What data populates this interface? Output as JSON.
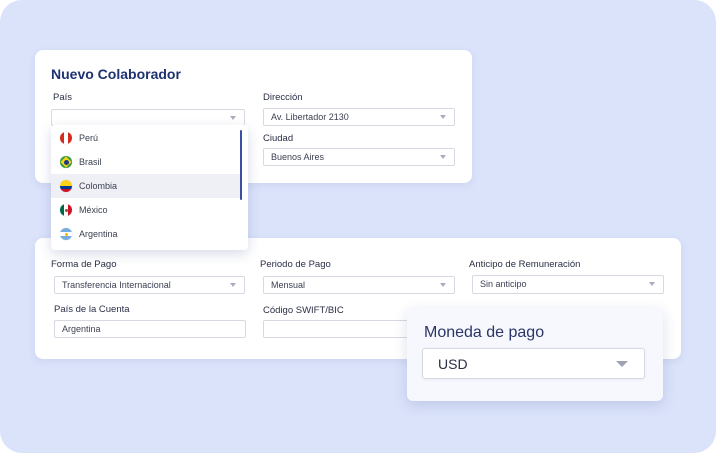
{
  "form_title": "Nuevo Colaborador",
  "top": {
    "pais": {
      "label": "País",
      "value": ""
    },
    "direccion": {
      "label": "Dirección",
      "value": "Av. Libertador 2130"
    },
    "ciudad": {
      "label": "Ciudad",
      "value": "Buenos Aires"
    }
  },
  "dropdown": {
    "items": [
      {
        "label": "Perú",
        "flag": "peru-flag-icon",
        "selected": false
      },
      {
        "label": "Brasil",
        "flag": "brazil-flag-icon",
        "selected": false
      },
      {
        "label": "Colombia",
        "flag": "colombia-flag-icon",
        "selected": true
      },
      {
        "label": "México",
        "flag": "mexico-flag-icon",
        "selected": false
      },
      {
        "label": "Argentina",
        "flag": "argentina-flag-icon",
        "selected": false
      }
    ]
  },
  "bottom": {
    "forma_pago": {
      "label": "Forma de Pago",
      "value": "Transferencia Internacional"
    },
    "periodo_pago": {
      "label": "Periodo de Pago",
      "value": "Mensual"
    },
    "anticipo": {
      "label": "Anticipo de Remuneración",
      "value": "Sin anticipo"
    },
    "pais_cuenta": {
      "label": "País de la Cuenta",
      "value": "Argentina"
    },
    "swift": {
      "label": "Código SWIFT/BIC",
      "value": ""
    }
  },
  "moneda": {
    "label": "Moneda de pago",
    "value": "USD"
  },
  "colors": {
    "background": "#dbe3fb",
    "title": "#1f3170",
    "accent": "#3b4fa0",
    "selected_row": "#eef0f6"
  }
}
